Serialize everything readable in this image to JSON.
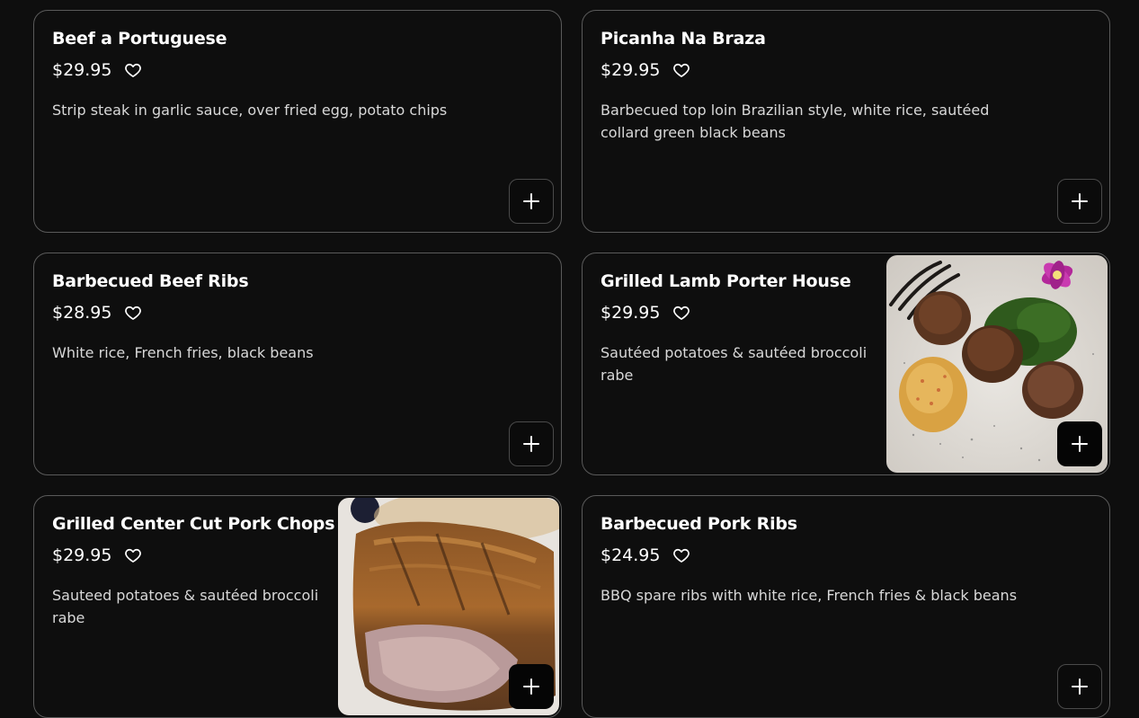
{
  "items": [
    {
      "name": "Beef a Portuguese",
      "price": "$29.95",
      "description": "Strip steak in garlic sauce, over fried egg, potato chips"
    },
    {
      "name": "Picanha Na Braza",
      "price": "$29.95",
      "description_lines": [
        "Barbecued top loin Brazilian style, white rice, sautéed",
        "collard green black beans"
      ]
    },
    {
      "name": "Barbecued Beef Ribs",
      "price": "$28.95",
      "description": "White rice, French fries, black beans"
    },
    {
      "name": "Grilled Lamb Porter House",
      "price": "$29.95",
      "description_lines": [
        "Sautéed potatoes & sautéed broccoli",
        "rabe"
      ],
      "image": "lamb-chops-on-plate-photo"
    },
    {
      "name": "Grilled Center Cut Pork Chops",
      "price": "$29.95",
      "description_lines": [
        "Sauteed potatoes & sautéed broccoli",
        "rabe"
      ],
      "image": "pork-chop-photo"
    },
    {
      "name": "Barbecued Pork Ribs",
      "price": "$24.95",
      "description": "BBQ spare ribs with white rice, French fries & black beans"
    }
  ],
  "icons": {
    "favorite": "heart-outline-icon",
    "add": "plus-icon"
  },
  "colors": {
    "background": "#0e0e0e",
    "card_border": "#5a5a5a",
    "text": "#ffffff",
    "description_text": "#d8d8d8"
  }
}
